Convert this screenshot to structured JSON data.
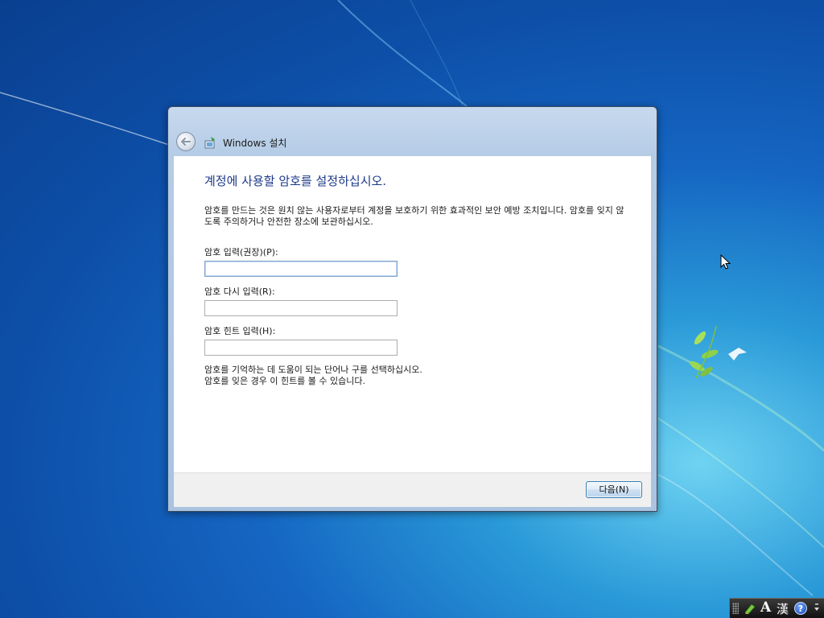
{
  "window": {
    "title": "Windows 설치"
  },
  "page": {
    "heading": "계정에 사용할 암호를 설정하십시오.",
    "description": "암호를 만드는 것은 원치 않는 사용자로부터 계정을 보호하기 위한 효과적인 보안 예방 조치입니다. 암호를 잊지 않도록 주의하거나 안전한 장소에 보관하십시오."
  },
  "fields": {
    "password_label": "암호 입력(권장)(P):",
    "password_value": "",
    "confirm_label": "암호 다시 입력(R):",
    "confirm_value": "",
    "hint_label": "암호 힌트 입력(H):",
    "hint_value": ""
  },
  "hint_note": {
    "line1": "암호를 기억하는 데 도움이 되는 단어나 구를 선택하십시오.",
    "line2": "암호를 잊은 경우 이 힌트를 볼 수 있습니다."
  },
  "footer": {
    "next_label": "다음(N)"
  },
  "language_bar": {
    "mode_a": "A",
    "mode_han": "漢",
    "help": "?"
  },
  "colors": {
    "heading": "#1e3a8a",
    "desktop_accent": "#1566c2"
  },
  "icons": [
    "back-arrow-icon",
    "setup-icon",
    "mouse-cursor-icon",
    "ime-pad-icon",
    "help-icon"
  ]
}
